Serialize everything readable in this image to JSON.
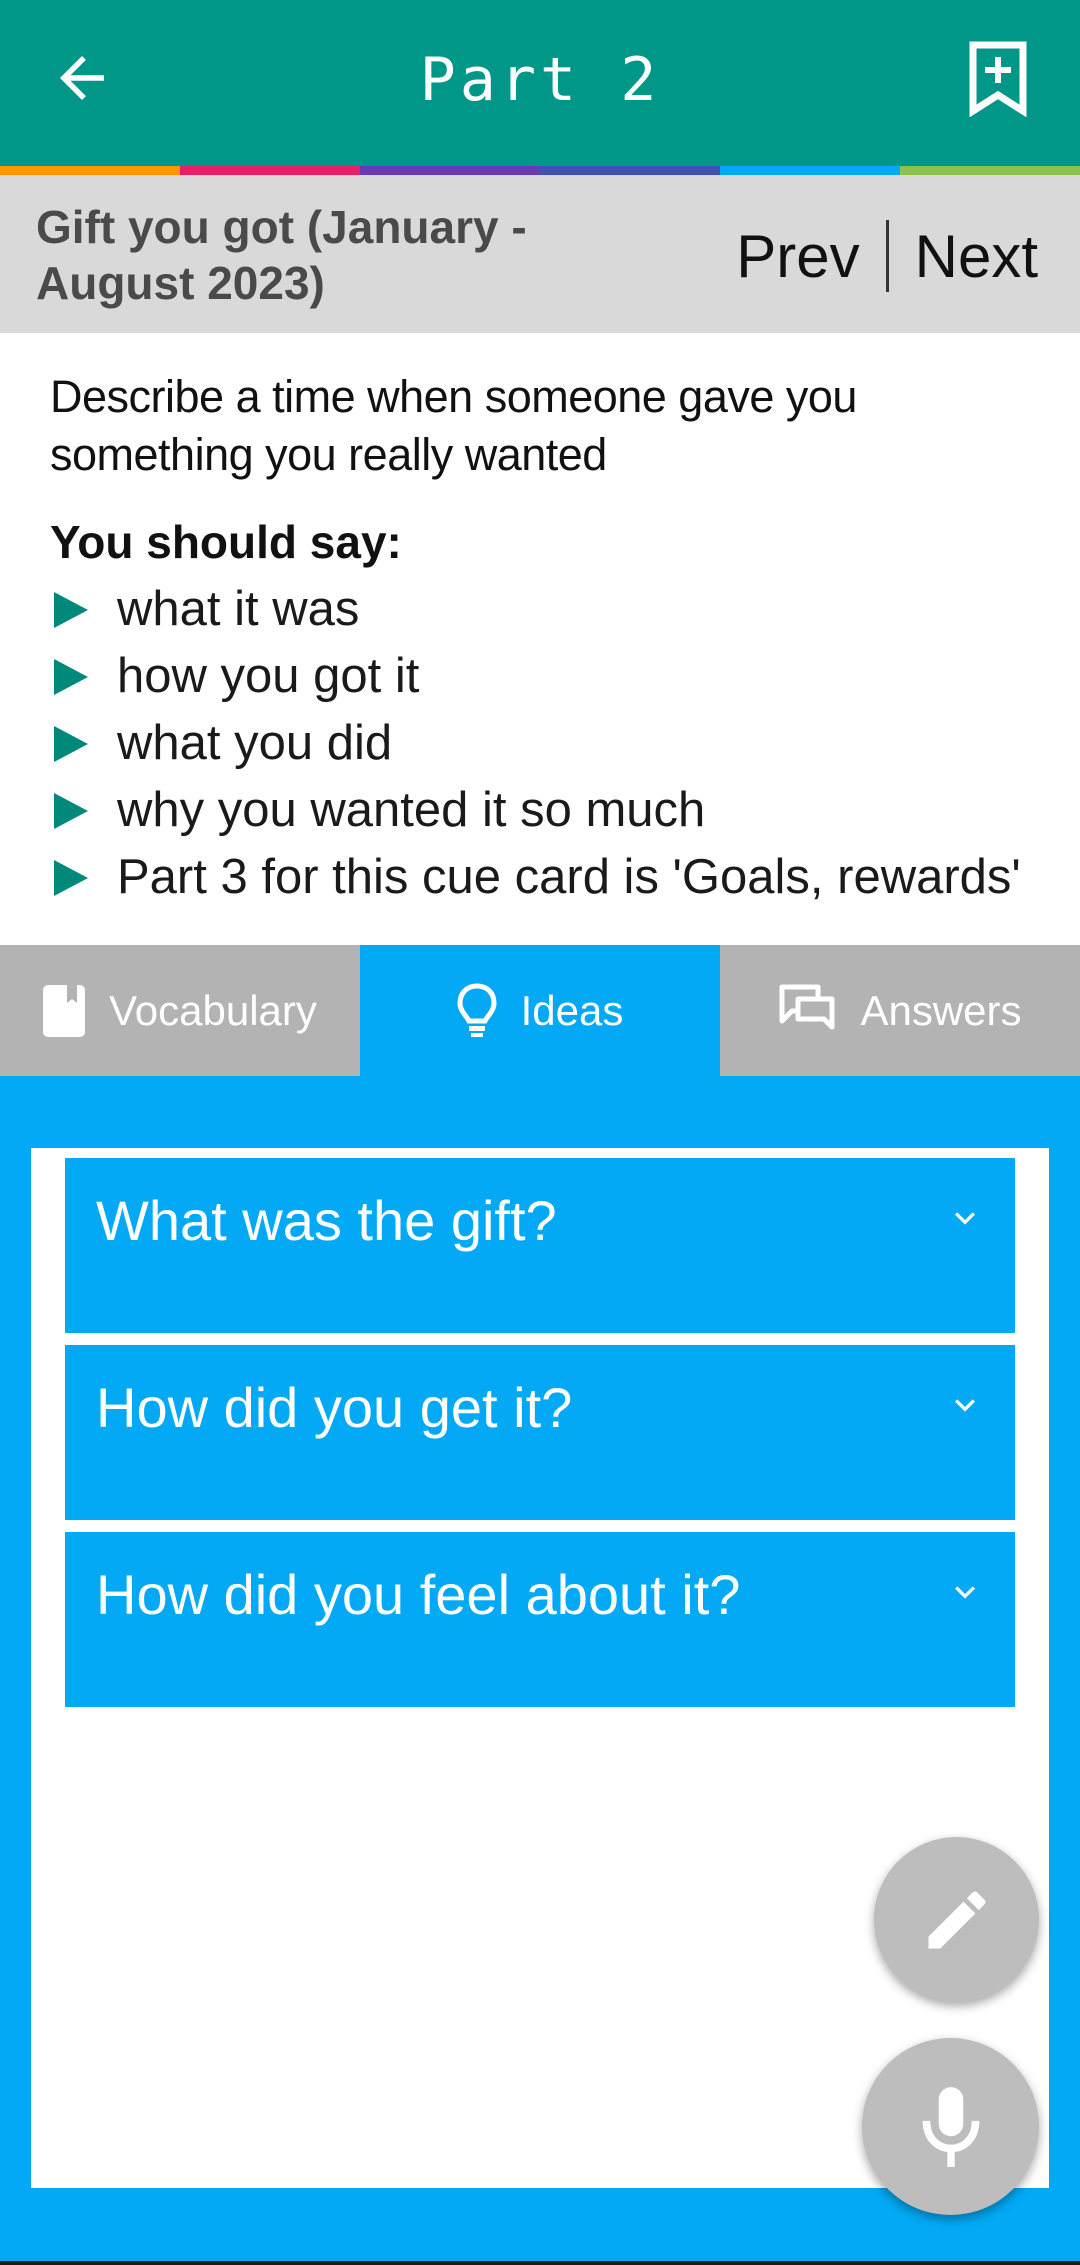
{
  "app_bar": {
    "title": "Part 2",
    "back_icon": "arrow-left-icon",
    "bookmark_icon": "bookmark-add-icon",
    "background": "#009688"
  },
  "color_strip": [
    "#ff9800",
    "#e91e63",
    "#673ab7",
    "#3f51b5",
    "#03a9f4",
    "#8bc34a"
  ],
  "topic": {
    "title_line1": "Gift you got (January -",
    "title_line2": "August 2023)",
    "prev_label": "Prev",
    "next_label": "Next"
  },
  "cue_card": {
    "description": "Describe a time when someone gave you something you really wanted",
    "you_should_say": "You should say:",
    "points": [
      "what it was",
      "how you got it",
      "what you did",
      "why you wanted it so much",
      "Part 3 for this cue card is 'Goals, rewards'"
    ],
    "bullet_color": "#00897b"
  },
  "tabs": [
    {
      "label": "Vocabulary",
      "icon": "book-icon",
      "active": false
    },
    {
      "label": "Ideas",
      "icon": "lightbulb-icon",
      "active": true
    },
    {
      "label": "Answers",
      "icon": "chat-bubbles-icon",
      "active": false
    }
  ],
  "ideas": {
    "questions": [
      "What was the gift?",
      "How did you get it?",
      "How did you feel about it?"
    ],
    "accent": "#03a9f4"
  },
  "fabs": {
    "edit_icon": "pencil-icon",
    "mic_icon": "microphone-icon"
  }
}
